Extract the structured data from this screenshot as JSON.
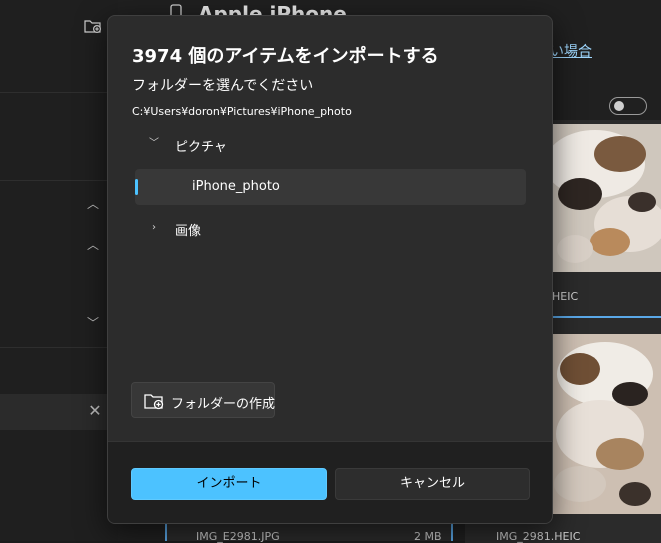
{
  "background": {
    "app_title": "Apple iPhone",
    "link": "い場合",
    "files": [
      {
        "name": "HEIC",
        "size": ""
      },
      {
        "name": "IMG_E2981.JPG",
        "size": "2 MB"
      },
      {
        "name": "IMG_2981.HEIC",
        "size": ""
      }
    ]
  },
  "dialog": {
    "title": "3974 個のアイテムをインポートする",
    "subtitle": "フォルダーを選んでください",
    "path": "C:¥Users¥doron¥Pictures¥iPhone_photo",
    "tree": [
      {
        "label": "ピクチャ",
        "expanded": true,
        "selected": false,
        "level": 0
      },
      {
        "label": "iPhone_photo",
        "expanded": false,
        "selected": true,
        "level": 1
      },
      {
        "label": "画像",
        "expanded": false,
        "selected": false,
        "level": 0
      }
    ],
    "new_folder_label": "フォルダーの作成",
    "import_label": "インポート",
    "cancel_label": "キャンセル"
  },
  "colors": {
    "accent": "#4cc2ff",
    "dialog_bg": "#2c2c2c",
    "footer_bg": "#202020",
    "selected_row": "#383838"
  }
}
